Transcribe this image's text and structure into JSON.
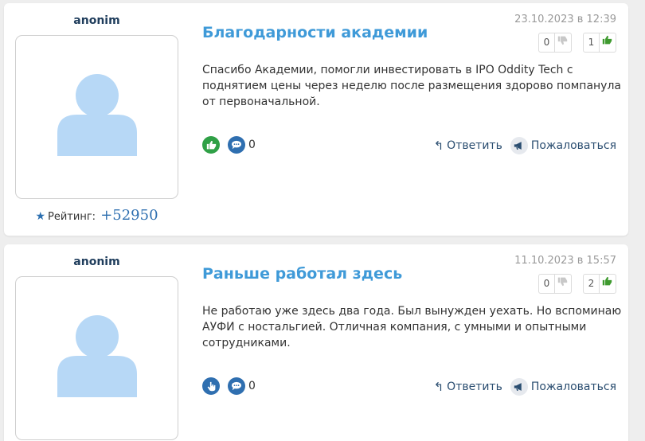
{
  "reviews": [
    {
      "author": "anonim",
      "rating_label": "Рейтинг:",
      "rating_value": "+52950",
      "title": "Благодарности академии",
      "date": "23.10.2023 в 12:39",
      "votes_down": "0",
      "votes_up": "1",
      "text": "Спасибо Академии, помогли инвестировать в IPO Oddity Tech с поднятием цены через неделю после размещения здорово помпанула от первоначальной.",
      "comments": "0",
      "reply_label": "Ответить",
      "complain_label": "Пожаловаться",
      "like_color": "#2fa046"
    },
    {
      "author": "anonim",
      "title": "Раньше работал здесь",
      "date": "11.10.2023 в 15:57",
      "votes_down": "0",
      "votes_up": "2",
      "text": "Не работаю уже здесь два года. Был вынужден уехать. Но вспоминаю АУФИ с ностальгией. Отличная компания, с умными и опытными сотрудниками.",
      "comments": "0",
      "reply_label": "Ответить",
      "complain_label": "Пожаловаться",
      "like_color": "#2f6fb0"
    }
  ],
  "icons": {
    "star": "star-icon",
    "thumb_down": "thumb-down-icon",
    "thumb_up": "thumb-up-icon",
    "comment": "comment-icon",
    "reply": "reply-icon",
    "megaphone": "megaphone-icon",
    "avatar": "avatar-placeholder-icon"
  }
}
